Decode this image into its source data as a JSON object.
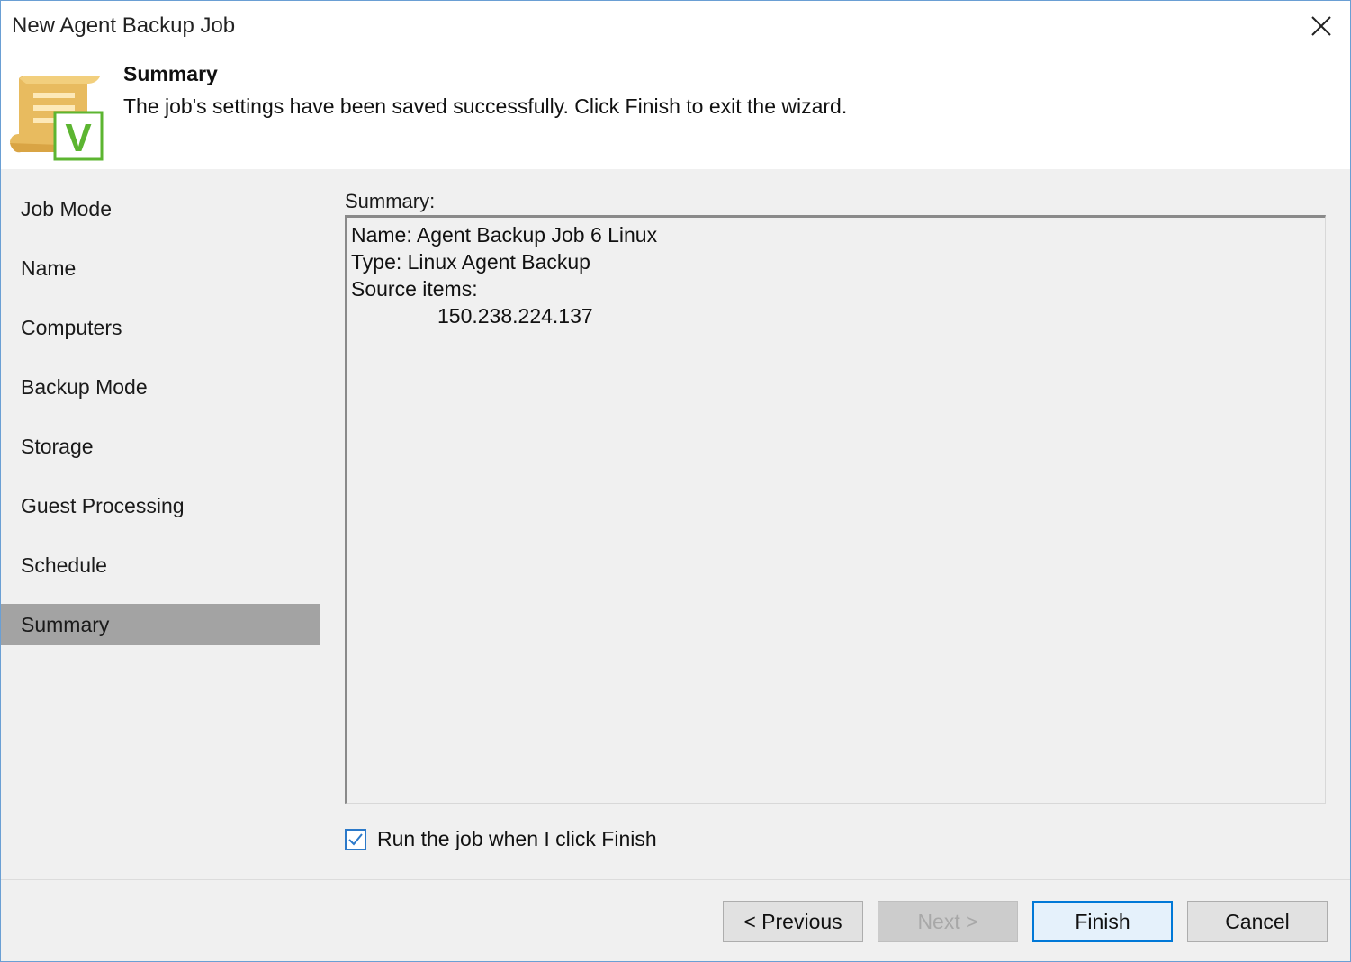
{
  "window": {
    "title": "New Agent Backup Job",
    "close_icon": "close-icon"
  },
  "header": {
    "icon": "scroll-check-icon",
    "heading": "Summary",
    "description": "The job's settings have been saved successfully. Click Finish to exit the wizard."
  },
  "sidebar": {
    "items": [
      {
        "label": "Job Mode",
        "active": false
      },
      {
        "label": "Name",
        "active": false
      },
      {
        "label": "Computers",
        "active": false
      },
      {
        "label": "Backup Mode",
        "active": false
      },
      {
        "label": "Storage",
        "active": false
      },
      {
        "label": "Guest Processing",
        "active": false
      },
      {
        "label": "Schedule",
        "active": false
      },
      {
        "label": "Summary",
        "active": true
      }
    ]
  },
  "summary": {
    "label": "Summary:",
    "lines": [
      "Name: Agent Backup Job 6 Linux",
      "Type: Linux Agent Backup",
      "Source items:",
      "150.238.224.137"
    ]
  },
  "run_option": {
    "label": "Run the job when I click Finish",
    "checked": true
  },
  "buttons": {
    "previous": "< Previous",
    "next": "Next >",
    "finish": "Finish",
    "cancel": "Cancel"
  },
  "colors": {
    "accent": "#0078d7",
    "active_nav": "#a3a3a3",
    "icon_scroll": "#e6b85c",
    "icon_check": "#5cb531"
  }
}
